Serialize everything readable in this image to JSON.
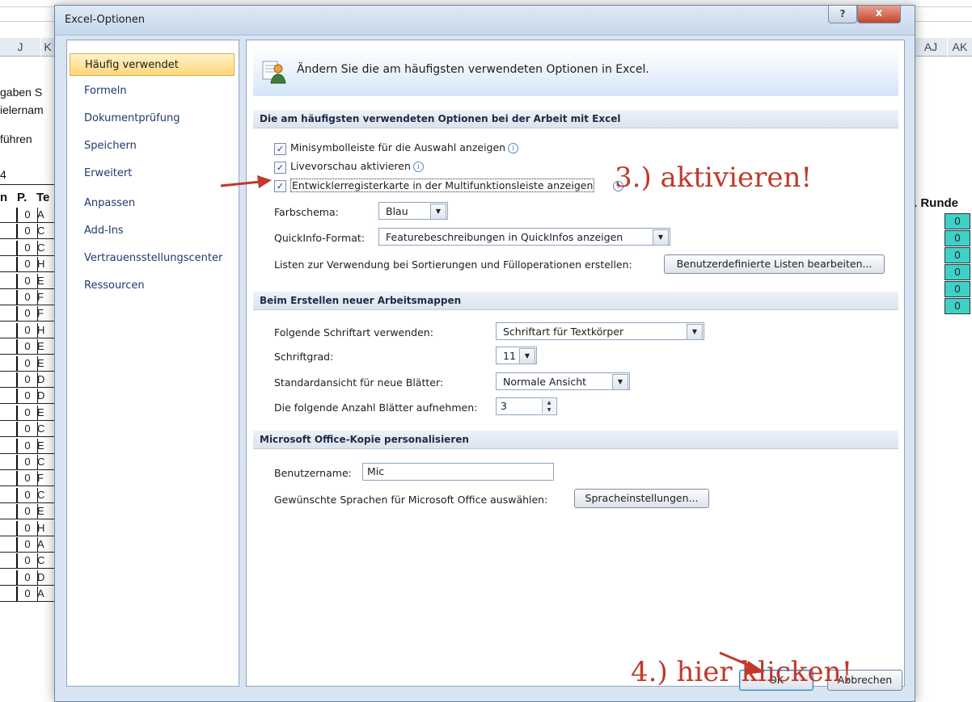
{
  "sheet": {
    "column_headers": {
      "left": [
        "J",
        "K"
      ],
      "right": [
        "AJ",
        "AK"
      ]
    },
    "left_texts": [
      "gaben S",
      "ielernam",
      "führen"
    ],
    "left_cell": "4",
    "header_left": {
      "col1": "n",
      "col2": "P.",
      "col3": "Te"
    },
    "header_right": ". Runde",
    "left_rows": [
      {
        "p": "0",
        "t": "A"
      },
      {
        "p": "0",
        "t": "C"
      },
      {
        "p": "0",
        "t": "C"
      },
      {
        "p": "0",
        "t": "H"
      },
      {
        "p": "0",
        "t": "E"
      },
      {
        "p": "0",
        "t": "F"
      },
      {
        "p": "0",
        "t": "F"
      },
      {
        "p": "0",
        "t": "H"
      },
      {
        "p": "0",
        "t": "E"
      },
      {
        "p": "0",
        "t": "E"
      },
      {
        "p": "0",
        "t": "D"
      },
      {
        "p": "0",
        "t": "D"
      },
      {
        "p": "0",
        "t": "E"
      },
      {
        "p": "0",
        "t": "C"
      },
      {
        "p": "0",
        "t": "E"
      },
      {
        "p": "0",
        "t": "C"
      },
      {
        "p": "0",
        "t": "F"
      },
      {
        "p": "0",
        "t": "C"
      },
      {
        "p": "0",
        "t": "E"
      },
      {
        "p": "0",
        "t": "H"
      },
      {
        "p": "0",
        "t": "A"
      },
      {
        "p": "0",
        "t": "C"
      },
      {
        "p": "0",
        "t": "D"
      },
      {
        "p": "0",
        "t": "A"
      }
    ],
    "right_rows": [
      "0",
      "0",
      "0",
      "0",
      "0",
      "0"
    ]
  },
  "dialog": {
    "title": "Excel-Optionen",
    "help_label": "?",
    "close_label": "x",
    "nav": [
      {
        "label": "Häufig verwendet",
        "selected": true
      },
      {
        "label": "Formeln"
      },
      {
        "label": "Dokumentprüfung"
      },
      {
        "label": "Speichern"
      },
      {
        "label": "Erweitert"
      },
      {
        "label": "Anpassen"
      },
      {
        "label": "Add-Ins"
      },
      {
        "label": "Vertrauensstellungscenter"
      },
      {
        "label": "Ressourcen"
      }
    ],
    "banner_text": "Ändern Sie die am häufigsten verwendeten Optionen in Excel.",
    "section1": {
      "title": "Die am häufigsten verwendeten Optionen bei der Arbeit mit Excel",
      "checkboxes": [
        {
          "label": "Minisymbolleiste für die Auswahl anzeigen",
          "checked": true
        },
        {
          "label": "Livevorschau aktivieren",
          "checked": true
        },
        {
          "label": "Entwicklerregisterkarte in der Multifunktionsleiste anzeigen",
          "checked": true
        }
      ],
      "info_glyph": "i",
      "check_glyph": "✓",
      "farbschema_label": "Farbschema:",
      "farbschema_value": "Blau",
      "quickinfo_label": "QuickInfo-Format:",
      "quickinfo_value": "Featurebeschreibungen in QuickInfos anzeigen",
      "lists_label": "Listen zur Verwendung bei Sortierungen und Fülloperationen erstellen:",
      "lists_button": "Benutzerdefinierte Listen bearbeiten..."
    },
    "section2": {
      "title": "Beim Erstellen neuer Arbeitsmappen",
      "font_label": "Folgende Schriftart verwenden:",
      "font_value": "Schriftart für Textkörper",
      "size_label": "Schriftgrad:",
      "size_value": "11",
      "view_label": "Standardansicht für neue Blätter:",
      "view_value": "Normale Ansicht",
      "sheets_label": "Die folgende Anzahl Blätter aufnehmen:",
      "sheets_value": "3"
    },
    "section3": {
      "title": "Microsoft Office-Kopie personalisieren",
      "username_label": "Benutzername:",
      "username_value": "Mic",
      "lang_label": "Gewünschte Sprachen für Microsoft Office auswählen:",
      "lang_button": "Spracheinstellungen..."
    },
    "ok_label": "OK",
    "cancel_label": "Abbrechen"
  },
  "annotations": {
    "step3": "3.) aktivieren!",
    "step4": "4.) hier klicken!",
    "color": "#c0392b"
  },
  "colors": {
    "accent": "#ffd77a",
    "teal_cells": "#3fd1c6"
  }
}
